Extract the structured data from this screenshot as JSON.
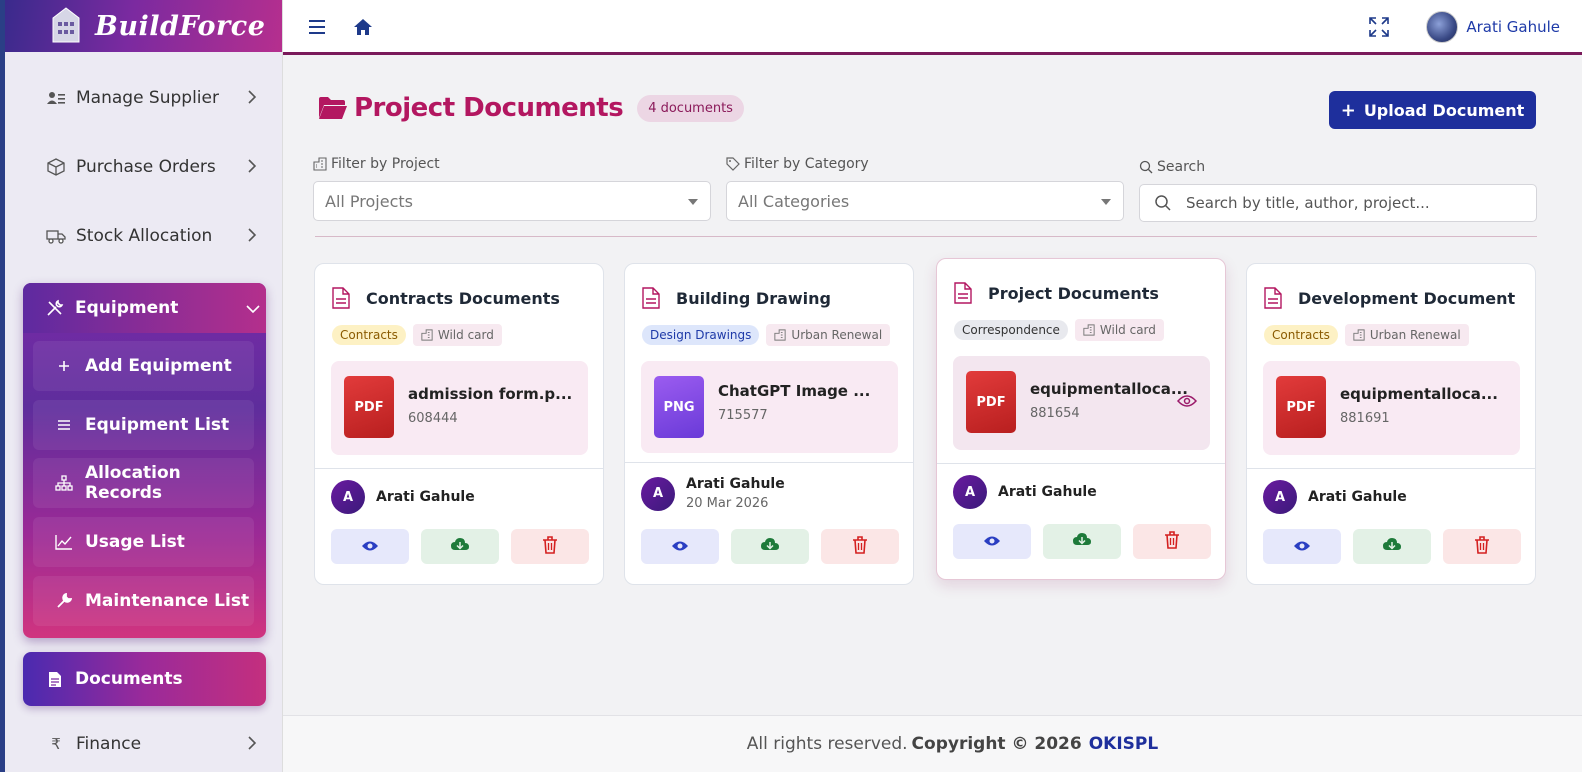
{
  "brand": {
    "name": "BuildForce"
  },
  "sidebar": {
    "items": [
      {
        "label": "Manage Supplier",
        "icon": "user-list-icon"
      },
      {
        "label": "Purchase Orders",
        "icon": "box-icon"
      },
      {
        "label": "Stock Allocation",
        "icon": "truck-icon"
      }
    ],
    "equipment": {
      "label": "Equipment",
      "icon": "tools-icon",
      "subitems": [
        {
          "label": "Add Equipment",
          "icon": "plus-icon"
        },
        {
          "label": "Equipment List",
          "icon": "list-icon"
        },
        {
          "label": "Allocation Records",
          "icon": "hierarchy-icon"
        },
        {
          "label": "Usage List",
          "icon": "chart-line-icon"
        },
        {
          "label": "Maintenance List",
          "icon": "wrench-icon"
        }
      ]
    },
    "documents": {
      "label": "Documents",
      "icon": "document-icon"
    },
    "finance": {
      "label": "Finance",
      "icon": "rupee-icon"
    }
  },
  "topbar": {
    "user_name": "Arati Gahule"
  },
  "page": {
    "title": "Project Documents",
    "count_badge": "4 documents",
    "upload_label": "Upload Document"
  },
  "filters": {
    "project": {
      "label": "Filter by Project",
      "value": "All Projects"
    },
    "category": {
      "label": "Filter by Category",
      "value": "All Categories"
    },
    "search": {
      "label": "Search",
      "placeholder": "Search by title, author, project..."
    }
  },
  "cards": [
    {
      "title": "Contracts Documents",
      "category": "Contracts",
      "project": "Wild card",
      "file_type": "PDF",
      "file_name": "admission form.p...",
      "file_size": "608444",
      "author": "Arati Gahule",
      "author_initial": "A",
      "date": ""
    },
    {
      "title": "Building Drawing",
      "category": "Design Drawings",
      "project": "Urban Renewal",
      "file_type": "PNG",
      "file_name": "ChatGPT Image ...",
      "file_size": "715577",
      "author": "Arati Gahule",
      "author_initial": "A",
      "date": "20 Mar 2026"
    },
    {
      "title": "Project Documents",
      "category": "Correspondence",
      "project": "Wild card",
      "file_type": "PDF",
      "file_name": "equipmentalloca...",
      "file_size": "881654",
      "author": "Arati Gahule",
      "author_initial": "A",
      "date": ""
    },
    {
      "title": "Development Document",
      "category": "Contracts",
      "project": "Urban Renewal",
      "file_type": "PDF",
      "file_name": "equipmentalloca...",
      "file_size": "881691",
      "author": "Arati Gahule",
      "author_initial": "A",
      "date": ""
    }
  ],
  "footer": {
    "text": "All rights reserved.",
    "copyright": "Copyright © 2026",
    "company": "OKISPL"
  },
  "colors": {
    "accent": "#b31760",
    "primary": "#1e2f9c",
    "sidebar_gradient_start": "#5e2aa0",
    "sidebar_gradient_end": "#d0347f"
  }
}
